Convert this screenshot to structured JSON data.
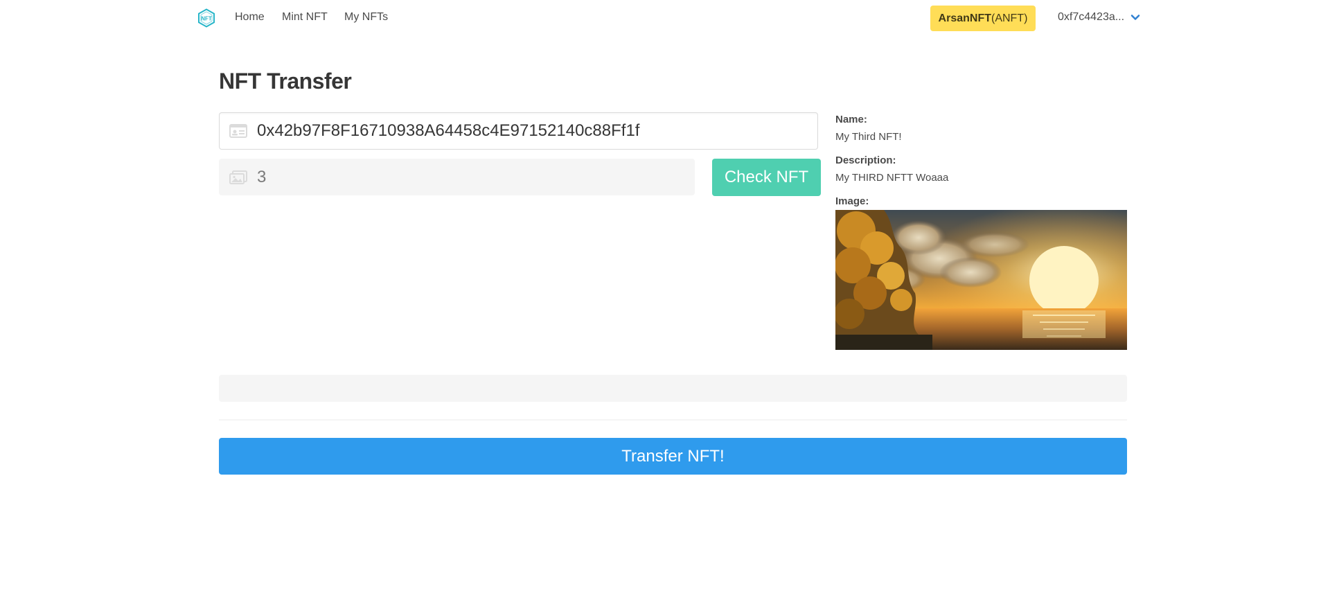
{
  "nav": {
    "logo_icon": "nft-hexagon-logo",
    "links": [
      "Home",
      "Mint NFT",
      "My NFTs"
    ],
    "token_name": "ArsanNFT",
    "token_symbol": "(ANFT)",
    "account": "0xf7c4423a...",
    "account_icon": "chevron-down-icon"
  },
  "page": {
    "title": "NFT Transfer"
  },
  "form": {
    "address_value": "0x42b97F8F16710938A64458c4E97152140c88Ff1f",
    "address_icon": "id-card-icon",
    "token_id_value": "3",
    "token_id_icon": "images-icon",
    "check_label": "Check NFT",
    "transfer_label": "Transfer NFT!",
    "status_text": ""
  },
  "nft": {
    "name_label": "Name:",
    "name": "My Third NFT!",
    "description_label": "Description:",
    "description": "My THIRD NFTT Woaaa",
    "image_label": "Image:"
  },
  "colors": {
    "badge": "#ffdd57",
    "check_button": "#4fcfb0",
    "transfer_button": "#2f9bed",
    "logo": "#29b6c9"
  }
}
